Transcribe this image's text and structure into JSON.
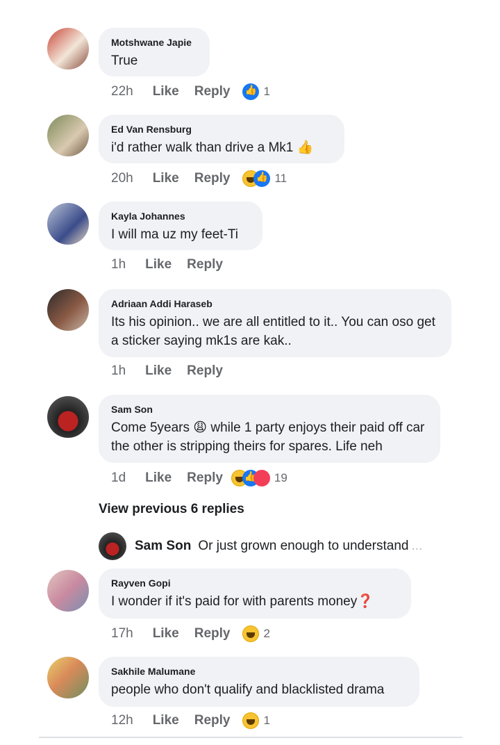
{
  "comments": [
    {
      "name": "Motshwane Japie",
      "text": "True",
      "time": "22h",
      "like": "Like",
      "reply": "Reply",
      "reaction_count": "1",
      "reaction": "like-icon"
    },
    {
      "name": "Ed Van Rensburg",
      "text": "i'd rather walk than drive a Mk1 👍",
      "time": "20h",
      "like": "Like",
      "reply": "Reply",
      "reaction_count": "11",
      "reaction": "haha-icon"
    },
    {
      "name": "Kayla Johannes",
      "text": "I will ma uz my feet-Ti",
      "time": "1h",
      "like": "Like",
      "reply": "Reply"
    },
    {
      "name": "Adriaan Addi Haraseb",
      "text": "Its his opinion.. we are all entitled to it.. You can oso get a sticker saying mk1s are kak..",
      "time": "1h",
      "like": "Like",
      "reply": "Reply"
    },
    {
      "name": "Sam Son",
      "text": "Come 5years 😩 while 1 party enjoys their paid off car the other is stripping theirs for spares. Life neh",
      "time": "1d",
      "like": "Like",
      "reply": "Reply",
      "reaction_count": "19",
      "reaction": "haha-icon"
    },
    {
      "name": "Rayven Gopi",
      "text": "I wonder if it's paid for with parents money❓",
      "time": "17h",
      "like": "Like",
      "reply": "Reply",
      "reaction_count": "2",
      "reaction": "haha-icon"
    },
    {
      "name": "Sakhile Malumane",
      "text": "people who don't qualify and blacklisted drama",
      "time": "12h",
      "like": "Like",
      "reply": "Reply",
      "reaction_count": "1",
      "reaction": "haha-icon"
    }
  ],
  "view_previous": "View previous 6 replies",
  "preview_reply": {
    "name": "Sam Son",
    "text": "Or just grown enough to understand",
    "ellipsis": "..."
  },
  "colors": {
    "bubble": "#f0f2f5",
    "meta": "#65676b",
    "like_blue": "#1877f2",
    "haha": "#f7c331"
  }
}
